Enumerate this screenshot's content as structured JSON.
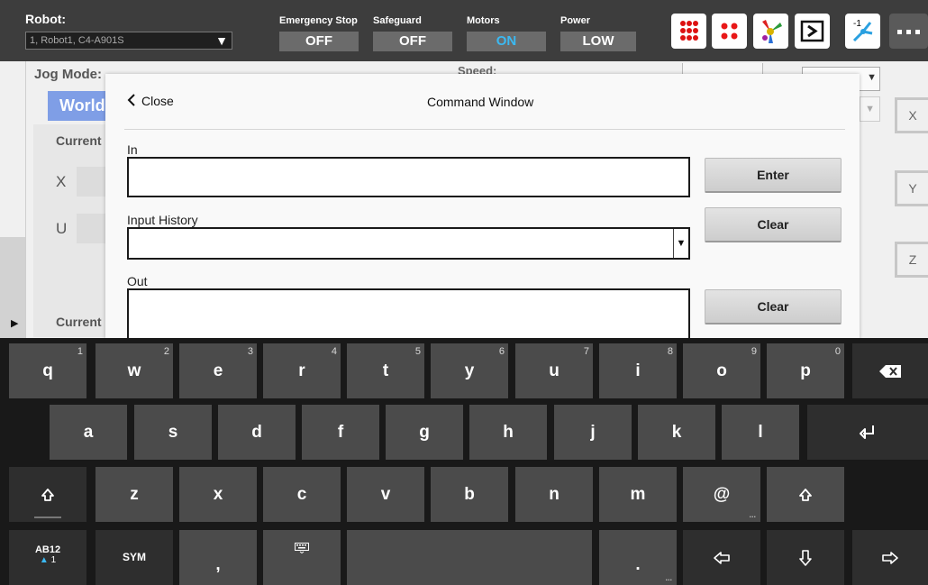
{
  "topbar": {
    "robot_label": "Robot:",
    "robot_value": "1, Robot1, C4-A901S",
    "estop_label": "Emergency Stop",
    "estop_value": "OFF",
    "safeguard_label": "Safeguard",
    "safeguard_value": "OFF",
    "motors_label": "Motors",
    "motors_value": "ON",
    "power_label": "Power",
    "power_value": "LOW",
    "icons": [
      "io-monitor-icon",
      "io-status-icon",
      "robot-jog-icon",
      "command-window-icon",
      "robot-manager-icon",
      "more-menu-icon"
    ]
  },
  "background": {
    "jog_mode_label": "Jog Mode:",
    "world_button": "World",
    "current_label_1": "Current",
    "x_label": "X",
    "u_label": "U",
    "current_label_2": "Current",
    "speed_label": "Speed:",
    "axis_x": "X",
    "axis_y": "Y",
    "axis_z": "Z"
  },
  "dialog": {
    "close_label": "Close",
    "title": "Command Window",
    "in_label": "In",
    "in_value": "",
    "enter_button": "Enter",
    "history_label": "Input History",
    "history_value": "",
    "clear_button_1": "Clear",
    "out_label": "Out",
    "out_value": "",
    "clear_button_2": "Clear"
  },
  "keyboard": {
    "row1": [
      {
        "key": "q",
        "hint": "1"
      },
      {
        "key": "w",
        "hint": "2"
      },
      {
        "key": "e",
        "hint": "3"
      },
      {
        "key": "r",
        "hint": "4"
      },
      {
        "key": "t",
        "hint": "5"
      },
      {
        "key": "y",
        "hint": "6"
      },
      {
        "key": "u",
        "hint": "7"
      },
      {
        "key": "i",
        "hint": "8"
      },
      {
        "key": "o",
        "hint": "9"
      },
      {
        "key": "p",
        "hint": "0"
      }
    ],
    "row2": [
      "a",
      "s",
      "d",
      "f",
      "g",
      "h",
      "j",
      "k",
      "l"
    ],
    "row3": [
      "z",
      "x",
      "c",
      "v",
      "b",
      "n",
      "m",
      "@"
    ],
    "mode_key": "AB12",
    "mode_sub": "1",
    "sym_key": "SYM",
    "comma_key": ",",
    "period_key": "."
  }
}
